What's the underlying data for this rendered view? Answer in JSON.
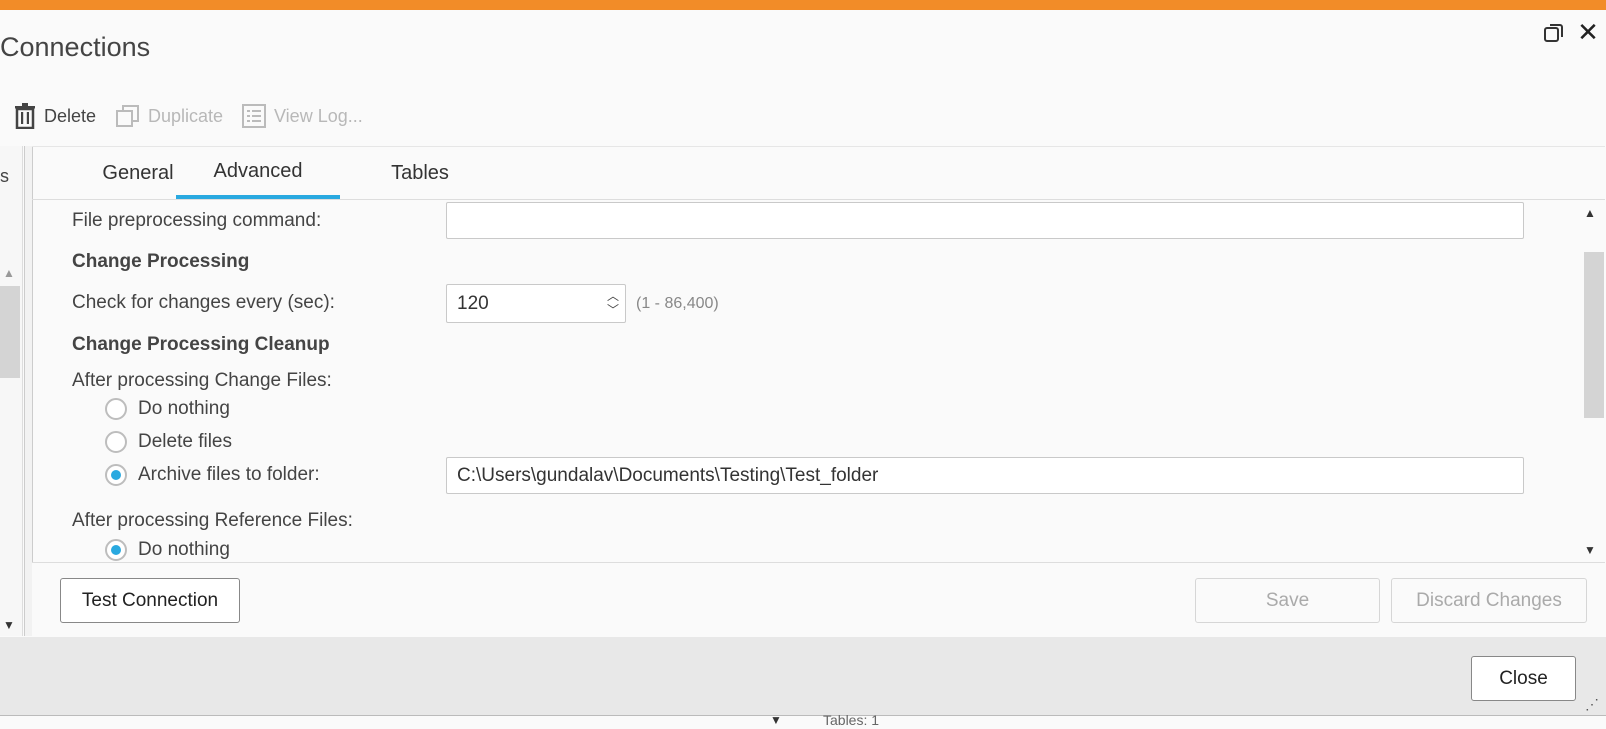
{
  "dialog": {
    "title": "Connections",
    "accent_color": "#f28c28"
  },
  "toolbar": {
    "delete_label": "Delete",
    "duplicate_label": "Duplicate",
    "view_log_label": "View Log..."
  },
  "left_panel": {
    "partial_text": "s"
  },
  "tabs": {
    "general": "General",
    "advanced": "Advanced",
    "tables": "Tables",
    "active": "Advanced",
    "active_color": "#29a9e0"
  },
  "form": {
    "preprocess_label": "File preprocessing command:",
    "preprocess_value": "",
    "change_processing_header": "Change Processing",
    "check_changes_label": "Check for changes every (sec):",
    "check_changes_value": "120",
    "check_changes_range": "(1 - 86,400)",
    "cleanup_header": "Change Processing Cleanup",
    "after_change_files_label": "After processing Change Files:",
    "change_options": {
      "do_nothing": "Do nothing",
      "delete_files": "Delete files",
      "archive": "Archive files to folder:"
    },
    "change_selected": "Archive files to folder:",
    "archive_folder_value": "C:\\Users\\gundalav\\Documents\\Testing\\Test_folder",
    "after_reference_files_label": "After processing Reference Files:",
    "reference_first_option": "Do nothing"
  },
  "buttons": {
    "test_connection": "Test Connection",
    "save": "Save",
    "discard": "Discard Changes",
    "close": "Close"
  },
  "background": {
    "tables_text": "Tables: 1"
  }
}
